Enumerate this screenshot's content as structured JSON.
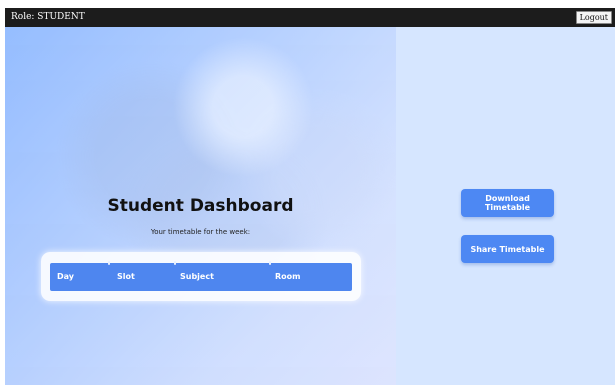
{
  "header": {
    "role_label": "Role: STUDENT",
    "logout_label": "Logout"
  },
  "dashboard": {
    "title": "Student Dashboard",
    "subtitle": "Your timetable for the week:",
    "table": {
      "columns": [
        "Day",
        "Slot",
        "Subject",
        "Room"
      ]
    }
  },
  "actions": {
    "download_label": "Download Timetable",
    "share_label": "Share Timetable"
  },
  "colors": {
    "topbar": "#1c1c1c",
    "accent": "#4d88f3",
    "side_panel": "#d6e6ff"
  }
}
